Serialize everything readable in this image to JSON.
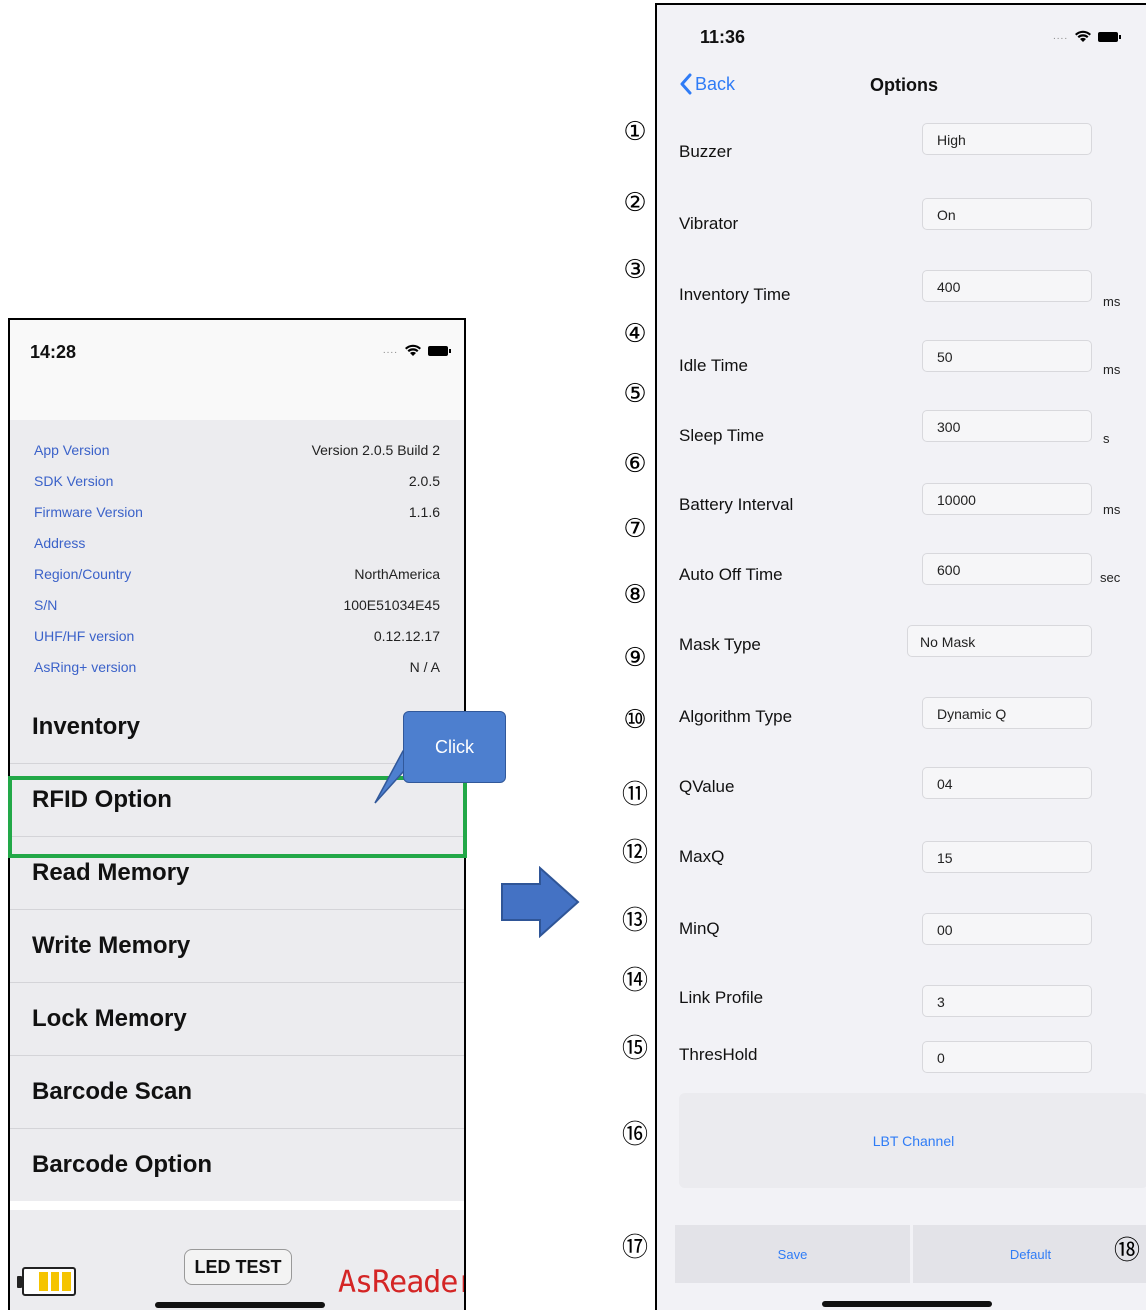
{
  "left_phone": {
    "time": "14:28",
    "info": [
      {
        "label": "App Version",
        "value": "Version 2.0.5 Build 2"
      },
      {
        "label": "SDK Version",
        "value": "2.0.5"
      },
      {
        "label": "Firmware Version",
        "value": "1.1.6"
      },
      {
        "label": "Address",
        "value": ""
      },
      {
        "label": "Region/Country",
        "value": "NorthAmerica"
      },
      {
        "label": "S/N",
        "value": "100E51034E45"
      },
      {
        "label": "UHF/HF version",
        "value": "0.12.12.17"
      },
      {
        "label": "AsRing+ version",
        "value": "N / A"
      }
    ],
    "menu": [
      "Inventory",
      "RFID Option",
      "Read Memory",
      "Write Memory",
      "Lock Memory",
      "Barcode Scan",
      "Barcode Option"
    ],
    "callout": "Click",
    "led_test": "LED TEST",
    "brand": "AsReader",
    "battery_level_cells": 3,
    "colors": {
      "highlight": "#22a848",
      "callout": "#4d7fcf",
      "brand": "#d42525",
      "link": "#3b62c9"
    }
  },
  "right_phone": {
    "time": "11:36",
    "back": "Back",
    "title": "Options",
    "options": [
      {
        "num": "①",
        "label": "Buzzer",
        "value": "High",
        "unit": ""
      },
      {
        "num": "②",
        "label": "Vibrator",
        "value": "On",
        "unit": ""
      },
      {
        "num": "③",
        "label": "Inventory Time",
        "value": "400",
        "unit": "ms"
      },
      {
        "num": "④",
        "label": "Idle Time",
        "value": "50",
        "unit": "ms"
      },
      {
        "num": "⑤",
        "label": "Sleep Time",
        "value": "300",
        "unit": "s"
      },
      {
        "num": "⑥",
        "label": "Battery Interval",
        "value": "10000",
        "unit": "ms"
      },
      {
        "num": "⑦",
        "label": "Auto Off Time",
        "value": "600",
        "unit": "sec"
      },
      {
        "num": "⑧",
        "label": "Mask Type",
        "value": "No Mask",
        "unit": ""
      },
      {
        "num": "⑨",
        "label": "",
        "value": "",
        "unit": ""
      },
      {
        "num": "⑩",
        "label": "Algorithm Type",
        "value": "Dynamic Q",
        "unit": ""
      },
      {
        "num": "⑪",
        "label": "QValue",
        "value": "04",
        "unit": ""
      },
      {
        "num": "⑫",
        "label": "MaxQ",
        "value": "15",
        "unit": ""
      },
      {
        "num": "⑬",
        "label": "MinQ",
        "value": "00",
        "unit": ""
      },
      {
        "num": "⑭",
        "label": "Link Profile",
        "value": "3",
        "unit": ""
      },
      {
        "num": "⑮",
        "label": "ThresHold",
        "value": "0",
        "unit": ""
      }
    ],
    "num16": "⑯",
    "num17": "⑰",
    "num18": "⑱",
    "lbt": "LBT Channel",
    "save": "Save",
    "default": "Default",
    "colors": {
      "accent": "#2f7cf6"
    }
  }
}
